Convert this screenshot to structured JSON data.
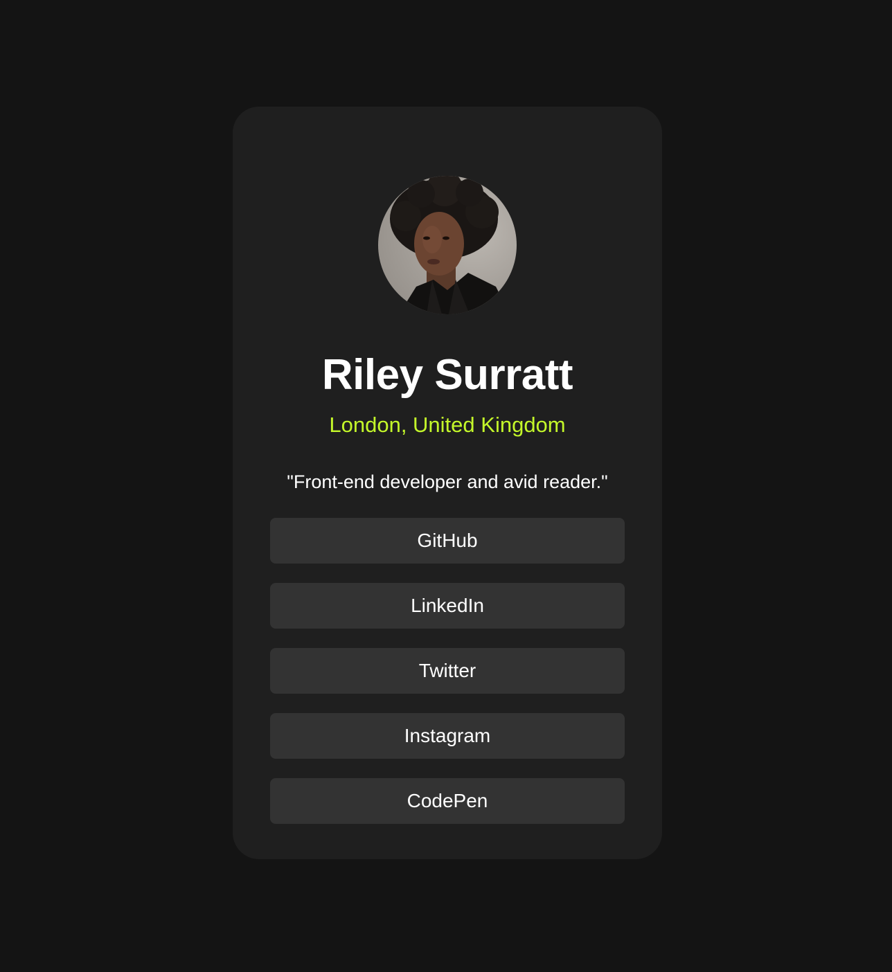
{
  "profile": {
    "avatar_alt": "profile photo",
    "name": "Riley Surratt",
    "location": "London, United Kingdom",
    "bio": "\"Front-end developer and avid reader.\""
  },
  "links": [
    {
      "label": "GitHub"
    },
    {
      "label": "LinkedIn"
    },
    {
      "label": "Twitter"
    },
    {
      "label": "Instagram"
    },
    {
      "label": "CodePen"
    }
  ],
  "colors": {
    "page_background": "#141414",
    "card_background": "#1f1f1f",
    "button_background": "#333333",
    "accent": "#c4f82a",
    "text": "#ffffff"
  }
}
